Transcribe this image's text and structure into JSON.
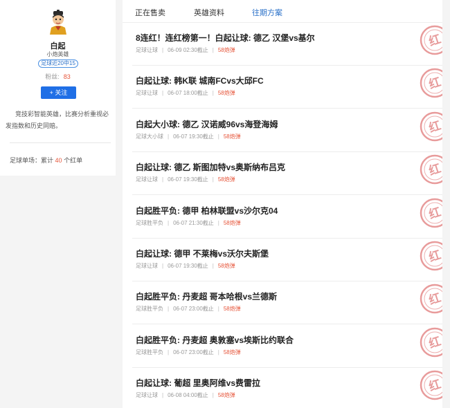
{
  "profile": {
    "name": "白起",
    "title": "小炮英雄",
    "badge": "足球近20中15",
    "fans_label": "粉丝:",
    "fans_count": "83",
    "follow_label": "+ 关注",
    "description": "竞技彩智能英雄，比赛分析重视必发指数和历史同赔。",
    "stats_prefix": "足球单场：累计",
    "stats_count": "40",
    "stats_suffix": "个红单"
  },
  "tabs": [
    {
      "label": "正在售卖",
      "active": false
    },
    {
      "label": "英雄资料",
      "active": false
    },
    {
      "label": "往期方案",
      "active": true
    }
  ],
  "items": [
    {
      "title": "8连红！连红榜第一！白起让球: 德乙 汉堡vs基尔",
      "category": "足球让球",
      "deadline": "06-09 02:30截止",
      "price": "58炮弹"
    },
    {
      "title": "白起让球: 韩K联 城南FCvs大邱FC",
      "category": "足球让球",
      "deadline": "06-07 18:00截止",
      "price": "58炮弹"
    },
    {
      "title": "白起大小球: 德乙 汉诺威96vs海登海姆",
      "category": "足球大小球",
      "deadline": "06-07 19:30截止",
      "price": "58炮弹"
    },
    {
      "title": "白起让球: 德乙 斯图加特vs奥斯纳布吕克",
      "category": "足球让球",
      "deadline": "06-07 19:30截止",
      "price": "58炮弹"
    },
    {
      "title": "白起胜平负: 德甲 柏林联盟vs沙尔克04",
      "category": "足球胜平负",
      "deadline": "06-07 21:30截止",
      "price": "58炮弹"
    },
    {
      "title": "白起让球: 德甲 不莱梅vs沃尔夫斯堡",
      "category": "足球让球",
      "deadline": "06-07 19:30截止",
      "price": "58炮弹"
    },
    {
      "title": "白起胜平负: 丹麦超 哥本哈根vs兰德斯",
      "category": "足球胜平负",
      "deadline": "06-07 23:00截止",
      "price": "58炮弹"
    },
    {
      "title": "白起胜平负: 丹麦超 奥敦塞vs埃斯比约联合",
      "category": "足球胜平负",
      "deadline": "06-07 23:00截止",
      "price": "58炮弹"
    },
    {
      "title": "白起让球: 葡超 里奥阿维vs费雷拉",
      "category": "足球让球",
      "deadline": "06-08 04:00截止",
      "price": "58炮弹"
    }
  ],
  "stamp_text": "红",
  "colors": {
    "accent": "#2a70c8",
    "button": "#1f6fe6",
    "price": "#e6553a",
    "stamp": "#e07a7a"
  }
}
